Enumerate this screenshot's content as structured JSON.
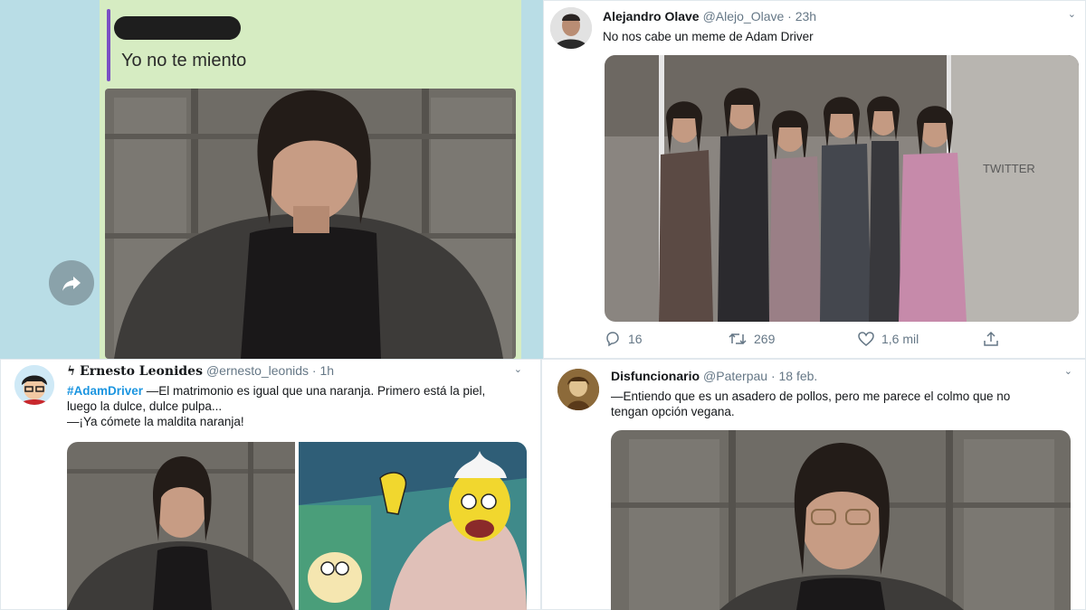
{
  "chat": {
    "quoted_text": "Yo no te miento"
  },
  "tweets": [
    {
      "name": "Alejandro Olave",
      "handle": "@Alejo_Olave · 23h",
      "text": "No nos cabe un meme  de Adam Driver",
      "media_watermark": "TWITTER",
      "replies": "16",
      "retweets": "269",
      "likes": "1,6 mil"
    },
    {
      "name": "ϟ Ernesto Leonides",
      "handle": "@ernesto_leonids · 1h",
      "hashtag": "#AdamDriver",
      "text_line1": " —El matrimonio es igual que una naranja. Primero está la piel,",
      "text_line2": "luego la dulce, dulce pulpa...",
      "text_line3": "—¡Ya cómete la maldita naranja!"
    },
    {
      "name": "Disfuncionario",
      "handle": "@Paterpau · 18 feb.",
      "text_line1": "—Entiendo que es un asadero de pollos, pero me parece el colmo que no",
      "text_line2": "tengan opción vegana."
    }
  ],
  "colors": {
    "chat_bg": "#b9dde6",
    "bubble": "#d6ecc2",
    "link_blue": "#1b95e0",
    "muted": "#657786"
  },
  "icons": [
    "forward-icon",
    "reply-icon",
    "retweet-icon",
    "like-icon",
    "share-icon",
    "chevron-down-icon"
  ]
}
